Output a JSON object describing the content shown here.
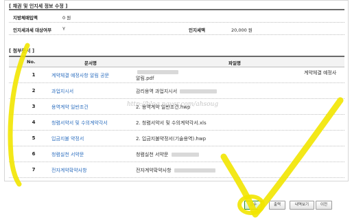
{
  "bond_section": {
    "title": "[ 채권 및 인지세 정보 수정 ]",
    "late_fee_label": "지방체매입액",
    "late_fee_value": "0 원",
    "stamp_tax_label": "인지세과세 대상여부",
    "stamp_tax_value": "Y",
    "stamp_amount_label": "인지세액",
    "stamp_amount_value": "20,000 원"
  },
  "attachments": {
    "title": "[ 첨부문서 ]",
    "headers": {
      "no": "No.",
      "doc_name": "문서명",
      "file_name": "파일명"
    },
    "rows": [
      {
        "no": "1",
        "doc_name": "계약체결 예정사항 알림 공문",
        "file_name": "알림.pdf",
        "file_name_2": "계약체결 예정사"
      },
      {
        "no": "2",
        "doc_name": "과업지시서",
        "file_name": "감리용역 과업지시서",
        "file_name_2": ""
      },
      {
        "no": "3",
        "doc_name": "용역계약 일반조건",
        "file_name": "2. 용역계약 일반조건.hwp",
        "file_name_2": ""
      },
      {
        "no": "4",
        "doc_name": "청렴서약서 및 수의계약각서",
        "file_name": "2. 청렴서약서 및 수의계약각서.xls",
        "file_name_2": ""
      },
      {
        "no": "5",
        "doc_name": "입금지불 약정서",
        "file_name": "2. 입금지불약정서(기술용역).hwp",
        "file_name_2": ""
      },
      {
        "no": "6",
        "doc_name": "청렴실천 서약문",
        "file_name": "청렴실천 서약문",
        "file_name_2": ""
      },
      {
        "no": "7",
        "doc_name": "전자계약확약사항",
        "file_name": "전자계약확약사항",
        "file_name_2": ""
      }
    ]
  },
  "watermark": "http://blog.naver.com/ahsoug",
  "buttons": {
    "confirm": "검수",
    "print": "출력",
    "history": "내역보기",
    "prev": "이전"
  },
  "colors": {
    "link": "#2e6fbf",
    "highlight": "#f2e500",
    "confirm_border": "#2a8c2a"
  }
}
